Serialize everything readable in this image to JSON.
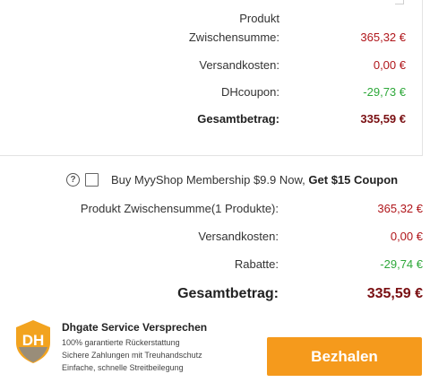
{
  "top_summary": {
    "subtotal_label_line1": "Produkt",
    "subtotal_label_line2": "Zwischensumme:",
    "subtotal_value": "365,32 €",
    "shipping_label": "Versandkosten:",
    "shipping_value": "0,00 €",
    "coupon_label": "DHcoupon:",
    "coupon_value": "-29,73 €",
    "total_label": "Gesamtbetrag:",
    "total_value": "335,59 €"
  },
  "bottom_summary": {
    "help_icon_glyph": "?",
    "membership_text": "Buy MyyShop Membership $9.9 Now,",
    "membership_bold": "Get $15 Coupon",
    "subtotal_label": "Produkt Zwischensumme(1 Produkte):",
    "subtotal_value": "365,32 €",
    "shipping_label": "Versandkosten:",
    "shipping_value": "0,00 €",
    "discount_label": "Rabatte:",
    "discount_value": "-29,74 €",
    "total_label": "Gesamtbetrag:",
    "total_value": "335,59 €"
  },
  "footer": {
    "logo_text": "DH",
    "service_title": "Dhgate Service Versprechen",
    "service_lines": [
      "100% garantierte Rückerstattung",
      "Sichere Zahlungen mit Treuhandschutz",
      "Einfache, schnelle Streitbeilegung"
    ],
    "pay_button_label": "Bezhalen"
  },
  "colors": {
    "price_red": "#b0161b",
    "discount_green": "#2ea83a",
    "total_dark_red": "#7a0f12",
    "pay_orange": "#f59a1c",
    "shield_orange": "#f2a31f"
  }
}
